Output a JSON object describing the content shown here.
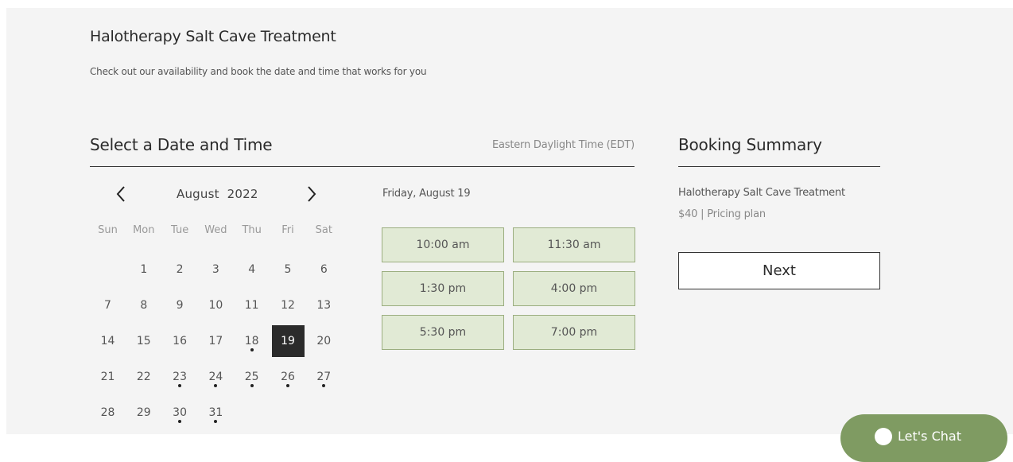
{
  "service": {
    "title": "Halotherapy Salt Cave Treatment",
    "subtitle": "Check out our availability and book the date and time that works for you"
  },
  "scheduler": {
    "section_title": "Select a Date and Time",
    "timezone": "Eastern Daylight Time (EDT)",
    "prev_icon": "chevron-left-icon",
    "next_icon": "chevron-right-icon",
    "month_label": "August  2022",
    "weekdays": [
      "Sun",
      "Mon",
      "Tue",
      "Wed",
      "Thu",
      "Fri",
      "Sat"
    ],
    "weeks": [
      [
        null,
        "1",
        "2",
        "3",
        "4",
        "5",
        "6"
      ],
      [
        "7",
        "8",
        "9",
        "10",
        "11",
        "12",
        "13"
      ],
      [
        "14",
        "15",
        "16",
        "17",
        "18",
        "19",
        "20"
      ],
      [
        "21",
        "22",
        "23",
        "24",
        "25",
        "26",
        "27"
      ],
      [
        "28",
        "29",
        "30",
        "31",
        null,
        null,
        null
      ]
    ],
    "available_days": [
      "18",
      "23",
      "24",
      "25",
      "26",
      "27",
      "30",
      "31"
    ],
    "selected_day": "19",
    "selected_date_label": "Friday, August 19",
    "time_slots": [
      "10:00 am",
      "11:30 am",
      "1:30 pm",
      "4:00 pm",
      "5:30 pm",
      "7:00 pm"
    ]
  },
  "summary": {
    "title": "Booking Summary",
    "service_name": "Halotherapy Salt Cave Treatment",
    "price_line": "$40 | Pricing plan",
    "next_label": "Next"
  },
  "chat": {
    "icon": "chat-icon",
    "label": "Let's Chat"
  },
  "colors": {
    "panel_bg": "#f4f4f4",
    "slot_bg": "#e1ead5",
    "slot_border": "#9bae80",
    "selected_day_bg": "#2b2b2b",
    "chat_bg": "#7f9b62"
  }
}
